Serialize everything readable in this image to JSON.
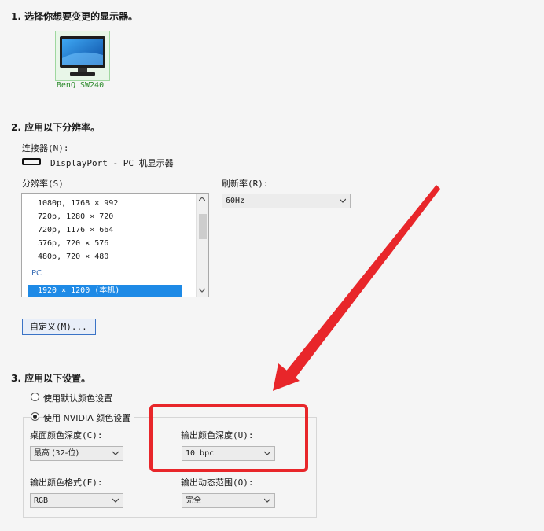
{
  "section1": {
    "title": "1. 选择你想要变更的显示器。"
  },
  "monitor": {
    "name": "BenQ SW240",
    "icon": "monitor-icon"
  },
  "section2": {
    "title": "2. 应用以下分辨率。",
    "connector_label": "连接器(N):",
    "connector_value": "DisplayPort - PC 机显示器",
    "resolution_label": "分辨率(S)",
    "resolution_rows": [
      "1080p, 1768 × 992",
      "720p, 1280 × 720",
      "720p, 1176 × 664",
      "576p, 720 × 576",
      "480p, 720 × 480"
    ],
    "group_pc": "PC",
    "selected_resolution": "1920 × 1200 (本机)",
    "refresh_label": "刷新率(R):",
    "refresh_value": "60Hz",
    "custom_button": "自定义(M)..."
  },
  "section3": {
    "title": "3. 应用以下设置。",
    "radio_default": "使用默认颜色设置",
    "radio_nvidia": "使用 NVIDIA 颜色设置",
    "desktop_depth_label": "桌面颜色深度(C):",
    "desktop_depth_value": "最高 (32-位)",
    "output_depth_label": "输出颜色深度(U):",
    "output_depth_value": "10 bpc",
    "output_format_label": "输出颜色格式(F):",
    "output_format_value": "RGB",
    "output_range_label": "输出动态范围(O):",
    "output_range_value": "完全"
  },
  "colors": {
    "selection": "#1e8ae6",
    "annotation_red": "#e8262a",
    "monitor_label": "#2e8b2e"
  }
}
